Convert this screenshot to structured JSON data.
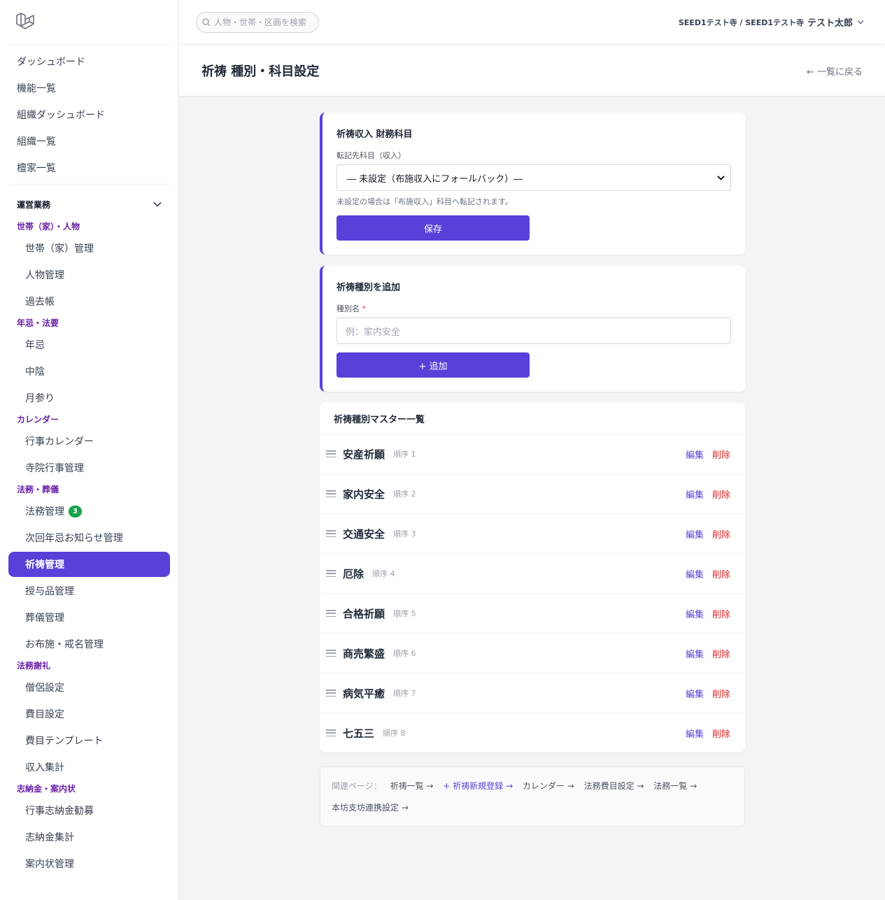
{
  "sidebar": {
    "top_items": [
      "ダッシュボード",
      "機能一覧",
      "組織ダッシュボード",
      "組織一覧",
      "檀家一覧"
    ],
    "section": "運営業務",
    "groups": [
      {
        "label": "世帯（家）・人物",
        "items": [
          "世帯（家）管理",
          "人物管理",
          "過去帳"
        ]
      },
      {
        "label": "年忌・法要",
        "items": [
          "年忌",
          "中陰",
          "月参り"
        ]
      },
      {
        "label": "カレンダー",
        "items": [
          "行事カレンダー",
          "寺院行事管理"
        ]
      },
      {
        "label": "法務・葬儀",
        "items": [
          "法務管理",
          "次回年忌お知らせ管理",
          "祈祷管理",
          "授与品管理",
          "葬儀管理",
          "お布施・戒名管理"
        ]
      },
      {
        "label": "法務謝礼",
        "items": [
          "僧侶設定",
          "費目設定",
          "費目テンプレート",
          "収入集計"
        ]
      },
      {
        "label": "志納金・案内状",
        "items": [
          "行事志納金勧募",
          "志納金集計",
          "案内状管理"
        ]
      }
    ],
    "badge_count": "3",
    "active_color": "#5841d8"
  },
  "topbar": {
    "search_placeholder": "人物・世帯・区画を検索",
    "org": "SEED1テスト寺 / SEED1テスト寺",
    "user": "テスト太郎"
  },
  "header": {
    "title": "祈祷 種別・科目設定",
    "back": "← 一覧に戻る"
  },
  "account_card": {
    "title": "祈祷収入 財務科目",
    "label": "転記先科目（収入）",
    "selected": "― 未設定（布施収入にフォールバック）―",
    "help": "未設定の場合は「布施収入」科目へ転記されます。",
    "save": "保存"
  },
  "add_card": {
    "title": "祈祷種別を追加",
    "label": "種別名",
    "required_mark": "*",
    "placeholder": "例：家内安全",
    "add": "+ 追加"
  },
  "list": {
    "title": "祈祷種別マスター一覧",
    "edit": "編集",
    "delete": "削除",
    "rows": [
      {
        "name": "安産祈願",
        "order": "順序 1"
      },
      {
        "name": "家内安全",
        "order": "順序 2"
      },
      {
        "name": "交通安全",
        "order": "順序 3"
      },
      {
        "name": "厄除",
        "order": "順序 4"
      },
      {
        "name": "合格祈願",
        "order": "順序 5"
      },
      {
        "name": "商売繁盛",
        "order": "順序 6"
      },
      {
        "name": "病気平癒",
        "order": "順序 7"
      },
      {
        "name": "七五三",
        "order": "順序 8"
      }
    ]
  },
  "related": {
    "label": "関連ページ：",
    "links": [
      "祈祷一覧 →",
      "+ 祈祷新規登録 →",
      "カレンダー →",
      "法務費目設定 →",
      "法務一覧 →",
      "本坊支坊連携設定 →"
    ]
  }
}
